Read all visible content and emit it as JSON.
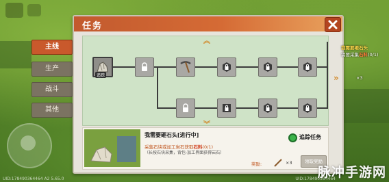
{
  "panel": {
    "title": "任务"
  },
  "tabs": [
    {
      "label": "主线",
      "active": true
    },
    {
      "label": "生产",
      "active": false
    },
    {
      "label": "战斗",
      "active": false
    },
    {
      "label": "其他",
      "active": false
    }
  ],
  "tree": {
    "track_tag": "追踪",
    "row1_node_icons": [
      "stone-pile-icon",
      "lock-icon",
      "pickaxe-icon",
      "lock-icon",
      "lock-icon",
      "lock-icon",
      "lock-icon"
    ],
    "row2_node_icons": [
      "lock-icon",
      "lock-icon",
      "lock-icon",
      "lock-icon"
    ]
  },
  "detail": {
    "title": "我需要砸石头[进行中]",
    "desc_line1_prefix": "采集石块或加工岩石获取",
    "desc_line1_highlight": "石料",
    "desc_line1_progress": "(0/1)",
    "desc_line2": "（长按石块采集，背包-加工界面获得岩石）",
    "reward_label": "奖励:",
    "reward_count": "×3",
    "track_label": "追踪任务",
    "claim_label": "领取奖励"
  },
  "side_info": {
    "warn": "我需要砸石头",
    "line2_prefix": "需要采集",
    "line2_highlight": "石料",
    "line2_progress": "(0/1)",
    "count": "×3"
  },
  "hud": {
    "uid_left": "UID:178490364464 A2 5.65.0",
    "uid_right": "UID:178490364464"
  },
  "watermark": "脉冲手游网",
  "colors": {
    "accent": "#c9592c",
    "title_bar": "#d56b35",
    "tree_bg": "#cfe3c7",
    "track_on": "#3bb34a"
  }
}
